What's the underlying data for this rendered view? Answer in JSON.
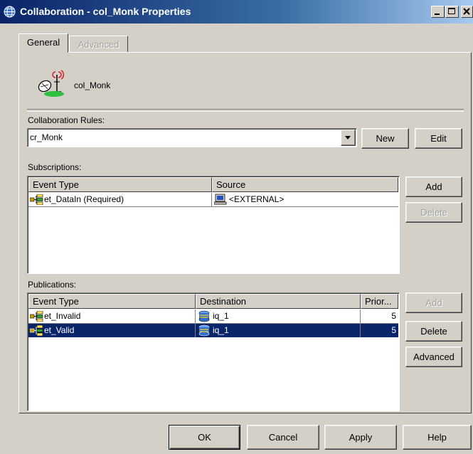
{
  "window": {
    "title": "Collaboration - col_Monk Properties"
  },
  "tabs": [
    {
      "label": "General"
    },
    {
      "label": "Advanced"
    }
  ],
  "general": {
    "object_name": "col_Monk",
    "collab_rules_label": "Collaboration Rules:",
    "collab_rules_value": "cr_Monk",
    "new_label": "New",
    "edit_label": "Edit",
    "subscriptions_label": "Subscriptions:",
    "subscriptions": {
      "columns": [
        "Event Type",
        "Source"
      ],
      "rows": [
        {
          "event_type": "et_DataIn (Required)",
          "source": "<EXTERNAL>"
        }
      ],
      "add_label": "Add",
      "delete_label": "Delete"
    },
    "publications_label": "Publications:",
    "publications": {
      "columns": [
        "Event Type",
        "Destination",
        "Prior..."
      ],
      "rows": [
        {
          "event_type": "et_Invalid",
          "destination": "iq_1",
          "priority": "5",
          "selected": false
        },
        {
          "event_type": "et_Valid",
          "destination": "iq_1",
          "priority": "5",
          "selected": true
        }
      ],
      "add_label": "Add",
      "delete_label": "Delete",
      "advanced_label": "Advanced"
    }
  },
  "footer": {
    "ok_label": "OK",
    "cancel_label": "Cancel",
    "apply_label": "Apply",
    "help_label": "Help"
  },
  "colors": {
    "face": "#d4d0c8",
    "title_gradient_start": "#0a246a",
    "title_gradient_end": "#a6caf0",
    "selection": "#0a246a"
  },
  "icons": {
    "title": "globe-icon",
    "object": "satellite-dish-icon",
    "event_type": "event-tree-icon",
    "external_source": "computer-icon",
    "queue": "queue-icon"
  }
}
